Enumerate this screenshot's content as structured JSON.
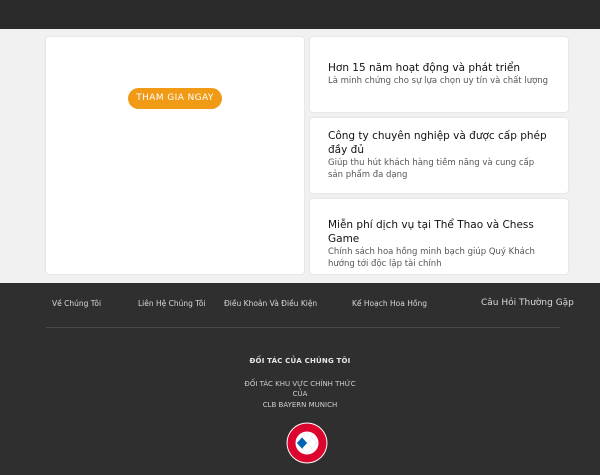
{
  "hero": {
    "cta_label": "THAM GIA NGAY"
  },
  "features": [
    {
      "title": "Hơn 15 năm hoạt động và phát triển",
      "desc": "Là minh chứng cho sự lựa chọn uy tín và chất lượng"
    },
    {
      "title": "Công ty chuyên nghiệp và được cấp phép đầy đủ",
      "desc": "Giúp thu hút khách hàng tiềm năng và cung cấp sản phẩm đa dạng"
    },
    {
      "title": "Miễn phí dịch vụ tại Thể Thao và Chess Game",
      "desc": "Chính sách hoa hồng minh bạch giúp Quý Khách hướng tới độc lập tài chính"
    }
  ],
  "footer": {
    "links": [
      "Về Chúng Tôi",
      "Liên Hệ Chúng Tôi",
      "Điều Khoản Và Điều Kiện",
      "Kế Hoạch Hoa Hồng",
      "Câu Hỏi Thường Gặp"
    ],
    "partners_title": "ĐỐI TÁC CỦA CHÚNG TÔI",
    "partner_lines": [
      "ĐỐI TÁC KHU VỰC CHÍNH THỨC",
      "CỦA",
      "CLB BAYERN MUNICH"
    ],
    "logo_text": "FC BAYERN MÜNCHEN"
  },
  "colors": {
    "cta": "#f09a16",
    "footer_bg": "#2f2f2f",
    "main_bg": "#f1f1f1",
    "bayern_red": "#dc052d",
    "bayern_blue": "#0066b2"
  }
}
